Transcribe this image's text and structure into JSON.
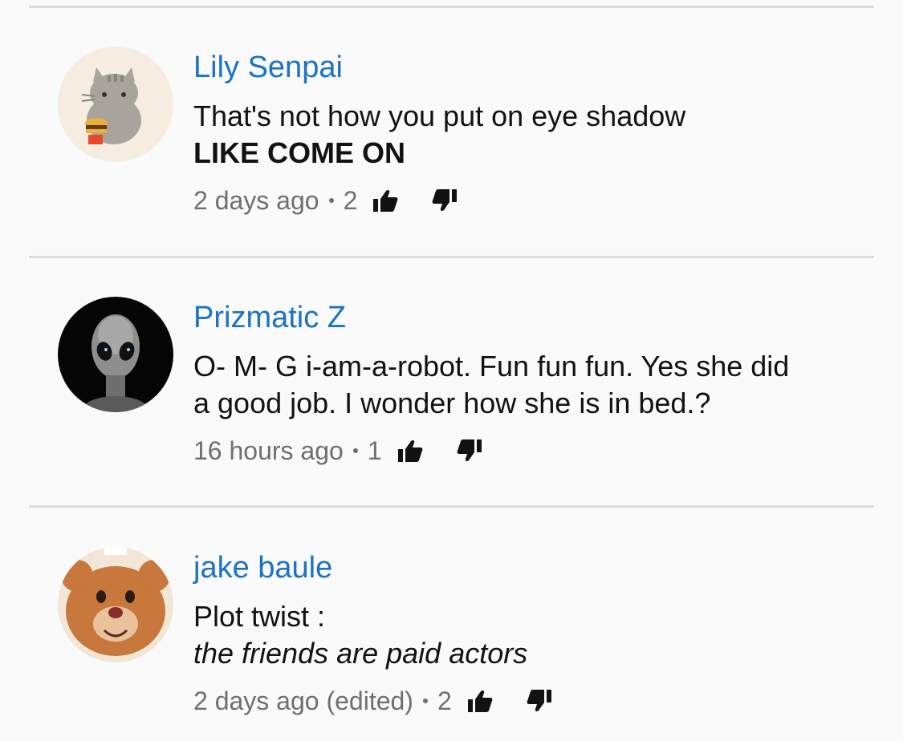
{
  "comments": [
    {
      "author": "Lily Senpai",
      "lines": [
        "That's not how you put on eye shadow",
        "LIKE COME ON"
      ],
      "timestamp": "2 days ago",
      "likes": "2",
      "avatar_icon": "pusheen-cat-avatar"
    },
    {
      "author": "Prizmatic Z",
      "lines": [
        "O- M- G i-am-a-robot. Fun fun fun. Yes she did",
        "a good job. I wonder how she is in bed.?"
      ],
      "timestamp": "16 hours ago",
      "likes": "1",
      "avatar_icon": "alien-avatar"
    },
    {
      "author": "jake baule",
      "lines": [
        "Plot twist :",
        "the friends are paid actors"
      ],
      "timestamp": "2 days ago (edited)",
      "likes": "2",
      "avatar_icon": "cartoon-bear-avatar"
    }
  ],
  "colors": {
    "author": "#1a73c7",
    "text": "#121212",
    "meta": "#6f6f6f",
    "divider": "#dcdcdc",
    "background": "#fafafa"
  }
}
